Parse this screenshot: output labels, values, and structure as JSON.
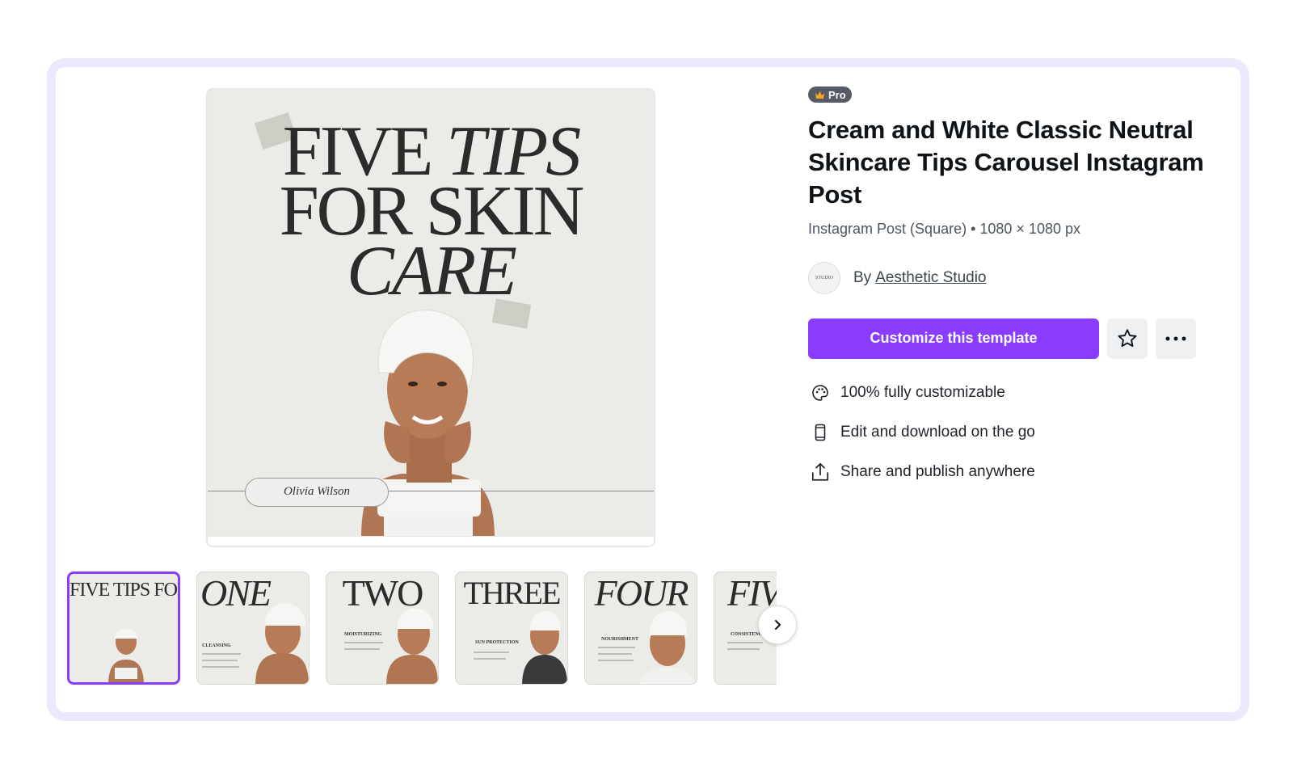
{
  "preview": {
    "headline_line1_a": "FIVE",
    "headline_line1_b": "TIPS",
    "headline_line2": "FOR SKIN",
    "headline_line3": "CARE",
    "name_pill": "Olivia Wilson"
  },
  "thumbnails": [
    {
      "title": "FIVE TIPS FOR SKIN CARE",
      "sub": "",
      "active": true
    },
    {
      "title": "ONE",
      "sub": "CLEANSING",
      "active": false
    },
    {
      "title": "TWO",
      "sub": "MOISTURIZING",
      "active": false
    },
    {
      "title": "THREE",
      "sub": "SUN PROTECTION",
      "active": false
    },
    {
      "title": "FOUR",
      "sub": "NOURISHMENT",
      "active": false
    },
    {
      "title": "FIVE",
      "sub": "CONSISTENCY",
      "active": false
    }
  ],
  "info": {
    "badge": "Pro",
    "title": "Cream and White Classic Neutral Skincare Tips Carousel Instagram Post",
    "meta": "Instagram Post (Square) • 1080 × 1080 px",
    "author_prefix": "By",
    "author_name": "Aesthetic Studio",
    "avatar_text": "STUDIO",
    "cta_label": "Customize this template",
    "features": [
      {
        "icon": "palette-icon",
        "label": "100% fully customizable"
      },
      {
        "icon": "phone-icon",
        "label": "Edit and download on the go"
      },
      {
        "icon": "share-icon",
        "label": "Share and publish anywhere"
      }
    ]
  },
  "colors": {
    "accent": "#8b3dff",
    "frame": "#ece8fd"
  }
}
